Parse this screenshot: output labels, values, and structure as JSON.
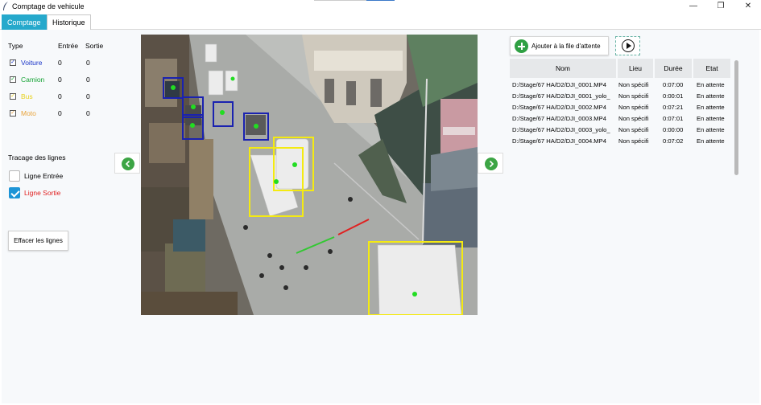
{
  "window": {
    "title": "Comptage de vehicule",
    "controls": {
      "minimize": "—",
      "maximize": "❐",
      "close": "✕"
    }
  },
  "tabs": [
    {
      "label": "Comptage",
      "active": true
    },
    {
      "label": "Historique",
      "active": false
    }
  ],
  "counts": {
    "headers": {
      "type": "Type",
      "in": "Entrée",
      "out": "Sortie"
    },
    "rows": [
      {
        "label": "Voiture",
        "color": "#1a35c8",
        "checked": true,
        "in": "0",
        "out": "0"
      },
      {
        "label": "Camion",
        "color": "#15a335",
        "checked": true,
        "in": "0",
        "out": "0"
      },
      {
        "label": "Bus",
        "color": "#e7d21d",
        "checked": true,
        "in": "0",
        "out": "0"
      },
      {
        "label": "Moto",
        "color": "#e8a33a",
        "checked": true,
        "in": "0",
        "out": "0"
      }
    ]
  },
  "lines": {
    "title": "Tracage des lignes",
    "entry": {
      "label": "Ligne Entrée",
      "checked": false,
      "color": "#000000"
    },
    "exit": {
      "label": "Ligne Sortie",
      "checked": true,
      "color": "#e02020"
    },
    "clear_button": "Effacer les lignes"
  },
  "queue": {
    "add_button": "Ajouter à la file d'attente",
    "play_icon": "play-circle-icon",
    "columns": [
      "Nom",
      "Lieu",
      "Durée",
      "Etat"
    ],
    "rows": [
      {
        "nom": "D:/Stage/67 HA/D2/DJI_0001.MP4",
        "lieu": "Non spécifi",
        "duree": "0:07:00",
        "etat": "En attente"
      },
      {
        "nom": "D:/Stage/67 HA/D2/DJI_0001_yolo_",
        "lieu": "Non spécifi",
        "duree": "0:00:01",
        "etat": "En attente"
      },
      {
        "nom": "D:/Stage/67 HA/D2/DJI_0002.MP4",
        "lieu": "Non spécifi",
        "duree": "0:07:21",
        "etat": "En attente"
      },
      {
        "nom": "D:/Stage/67 HA/D2/DJI_0003.MP4",
        "lieu": "Non spécifi",
        "duree": "0:07:01",
        "etat": "En attente"
      },
      {
        "nom": "D:/Stage/67 HA/D2/DJI_0003_yolo_",
        "lieu": "Non spécifi",
        "duree": "0:00:00",
        "etat": "En attente"
      },
      {
        "nom": "D:/Stage/67 HA/D2/DJI_0004.MP4",
        "lieu": "Non spécifi",
        "duree": "0:07:02",
        "etat": "En attente"
      }
    ]
  },
  "detection_colors": {
    "car_box": "#1a22b0",
    "bus_box": "#f4ea12",
    "centroid": "#22dd22"
  }
}
